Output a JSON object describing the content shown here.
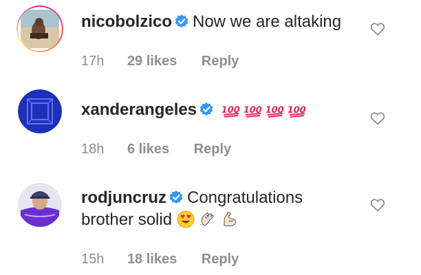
{
  "comments": [
    {
      "username": "nicobolzico",
      "text": "Now we are altaking",
      "time": "17h",
      "likes": "29 likes",
      "reply": "Reply",
      "emojis": []
    },
    {
      "username": "xanderangeles",
      "text": "",
      "time": "18h",
      "likes": "6 likes",
      "reply": "Reply",
      "emojis": [
        "hundred-points-icon",
        "hundred-points-icon",
        "hundred-points-icon",
        "hundred-points-icon"
      ]
    },
    {
      "username": "rodjuncruz",
      "text": "Congratulations",
      "text_line2": "brother solid",
      "time": "15h",
      "likes": "18 likes",
      "reply": "Reply",
      "emojis": [
        "heart-eyes-icon",
        "clapping-hands-icon",
        "flexed-biceps-icon"
      ]
    }
  ],
  "colors": {
    "text": "#262626",
    "meta": "#8e8e8e",
    "verified": "#3897f0"
  }
}
